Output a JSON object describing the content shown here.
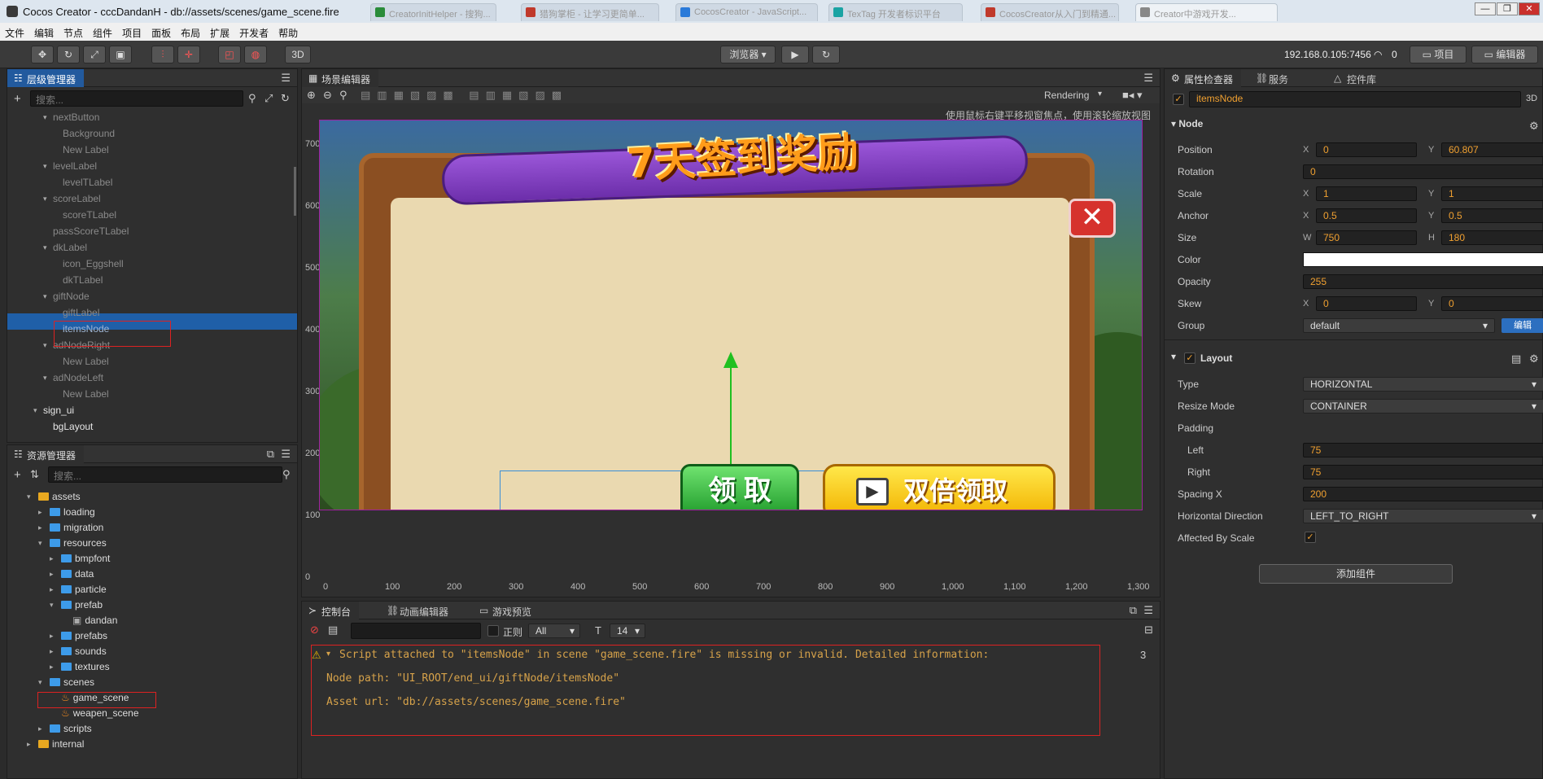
{
  "window": {
    "title": "Cocos Creator - cccDandanH - db://assets/scenes/game_scene.fire",
    "bg_tabs": [
      "CreatorInitHelper - 搜狗...",
      "猎狗掌柜 - 让学习更简单...",
      "CocosCreator - JavaScript...",
      "TexTag 开发者标识平台",
      "CocosCreator从入门到精通...",
      "Creator中游戏开发..."
    ],
    "win_buttons": [
      "—",
      "❐",
      "✕"
    ]
  },
  "menu": [
    "文件",
    "编辑",
    "节点",
    "组件",
    "项目",
    "面板",
    "布局",
    "扩展",
    "开发者",
    "帮助"
  ],
  "toolbar": {
    "mode_3d": "3D",
    "browser": "浏览器 ▾",
    "ip": "192.168.0.105:7456",
    "wifi_count": "0",
    "project_btn": "项目",
    "editor_btn": "编辑器"
  },
  "hierarchy": {
    "tab": "层级管理器",
    "search_placeholder": "搜索...",
    "items": [
      {
        "label": "nextButton",
        "tri": "▾"
      },
      {
        "label": "Background",
        "tri": ""
      },
      {
        "label": "New Label",
        "tri": ""
      },
      {
        "label": "levelLabel",
        "tri": "▾"
      },
      {
        "label": "levelTLabel",
        "tri": ""
      },
      {
        "label": "scoreLabel",
        "tri": "▾"
      },
      {
        "label": "scoreTLabel",
        "tri": ""
      },
      {
        "label": "passScoreTLabel",
        "tri": ""
      },
      {
        "label": "dkLabel",
        "tri": "▾"
      },
      {
        "label": "icon_Eggshell",
        "tri": ""
      },
      {
        "label": "dkTLabel",
        "tri": ""
      },
      {
        "label": "giftNode",
        "tri": "▾"
      },
      {
        "label": "giftLabel",
        "tri": ""
      },
      {
        "label": "itemsNode",
        "tri": ""
      },
      {
        "label": "adNodeRight",
        "tri": "▾"
      },
      {
        "label": "New Label",
        "tri": ""
      },
      {
        "label": "adNodeLeft",
        "tri": "▾"
      },
      {
        "label": "New Label",
        "tri": ""
      },
      {
        "label": "sign_ui",
        "tri": "▾"
      },
      {
        "label": "bgLayout",
        "tri": ""
      }
    ]
  },
  "assets": {
    "tab": "资源管理器",
    "search_placeholder": "搜索...",
    "items": [
      {
        "label": "assets",
        "tri": "▾"
      },
      {
        "label": "loading",
        "tri": "▸"
      },
      {
        "label": "migration",
        "tri": "▸"
      },
      {
        "label": "resources",
        "tri": "▾"
      },
      {
        "label": "bmpfont",
        "tri": "▸"
      },
      {
        "label": "data",
        "tri": "▸"
      },
      {
        "label": "particle",
        "tri": "▸"
      },
      {
        "label": "prefab",
        "tri": "▾"
      },
      {
        "label": "dandan",
        "tri": ""
      },
      {
        "label": "prefabs",
        "tri": "▸"
      },
      {
        "label": "sounds",
        "tri": "▸"
      },
      {
        "label": "textures",
        "tri": "▸"
      },
      {
        "label": "scenes",
        "tri": "▾"
      },
      {
        "label": "game_scene",
        "tri": ""
      },
      {
        "label": "weapen_scene",
        "tri": ""
      },
      {
        "label": "scripts",
        "tri": "▸"
      },
      {
        "label": "internal",
        "tri": "▸"
      }
    ]
  },
  "scene": {
    "tab": "场景编辑器",
    "rendering": "Rendering",
    "hint": "使用鼠标右键平移视窗焦点，使用滚轮缩放视图",
    "y_ticks": [
      "700",
      "600",
      "500",
      "400",
      "300",
      "200",
      "100",
      "0"
    ],
    "x_ticks": [
      "0",
      "100",
      "200",
      "300",
      "400",
      "500",
      "600",
      "700",
      "800",
      "900",
      "1,000",
      "1,100",
      "1,200",
      "1,300"
    ],
    "banner": "7天签到奖励",
    "btn_claim": "领 取",
    "btn_double": "双倍领取"
  },
  "console": {
    "tabs": [
      "控制台",
      "动画编辑器",
      "游戏预览"
    ],
    "regex_label": "正则",
    "level": "All",
    "font_size": "14",
    "lines": [
      "Script attached to \"itemsNode\" in scene \"game_scene.fire\" is missing or invalid. Detailed information:",
      "Node path: \"UI_ROOT/end_ui/giftNode/itemsNode\"",
      "Asset url: \"db://assets/scenes/game_scene.fire\""
    ],
    "count": "3"
  },
  "inspector": {
    "tabs": [
      "属性检查器",
      "服务",
      "控件库"
    ],
    "node_name": "itemsNode",
    "mode_3d": "3D",
    "node_section": "Node",
    "position": {
      "label": "Position",
      "x": "0",
      "y": "60.807"
    },
    "rotation": {
      "label": "Rotation",
      "v": "0"
    },
    "scale": {
      "label": "Scale",
      "x": "1",
      "y": "1"
    },
    "anchor": {
      "label": "Anchor",
      "x": "0.5",
      "y": "0.5"
    },
    "size": {
      "label": "Size",
      "w": "750",
      "h": "180"
    },
    "color": {
      "label": "Color"
    },
    "opacity": {
      "label": "Opacity",
      "v": "255"
    },
    "skew": {
      "label": "Skew",
      "x": "0",
      "y": "0"
    },
    "group": {
      "label": "Group",
      "v": "default",
      "edit": "编辑"
    },
    "layout_section": "Layout",
    "type": {
      "label": "Type",
      "v": "HORIZONTAL"
    },
    "resize": {
      "label": "Resize Mode",
      "v": "CONTAINER"
    },
    "padding": {
      "label": "Padding"
    },
    "left": {
      "label": "Left",
      "v": "75"
    },
    "right": {
      "label": "Right",
      "v": "75"
    },
    "spacing": {
      "label": "Spacing X",
      "v": "200"
    },
    "hdir": {
      "label": "Horizontal Direction",
      "v": "LEFT_TO_RIGHT"
    },
    "affected": {
      "label": "Affected By Scale"
    },
    "add_component": "添加组件",
    "axis_x": "X",
    "axis_y": "Y",
    "axis_w": "W",
    "axis_h": "H"
  },
  "colors": {
    "accent": "#225a9e",
    "warning": "#d6a24a",
    "field_value": "#f0a030"
  }
}
